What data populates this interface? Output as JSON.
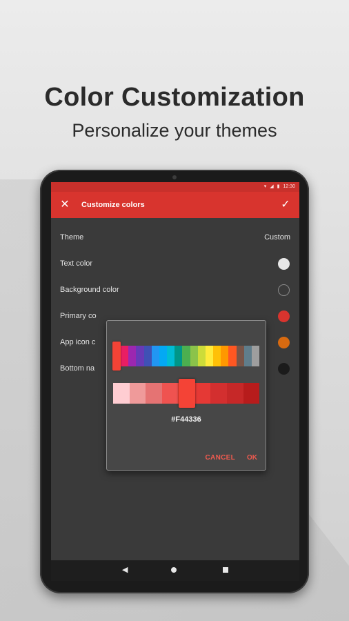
{
  "promo": {
    "headline": "Color Customization",
    "subheadline": "Personalize your themes"
  },
  "statusbar": {
    "time": "12:30",
    "icons": [
      "wifi-icon",
      "signal-icon",
      "battery-icon"
    ]
  },
  "appbar": {
    "title": "Customize colors",
    "close_icon": "close-icon",
    "confirm_icon": "check-icon",
    "color": "#d8342e"
  },
  "settings": [
    {
      "label": "Theme",
      "value": "Custom"
    },
    {
      "label": "Text color",
      "swatch": "#e8e8e8"
    },
    {
      "label": "Background color",
      "swatch": "#3a3a3a"
    },
    {
      "label": "Primary co",
      "swatch": "#d8342e"
    },
    {
      "label": "App icon c",
      "swatch": "#d86a10"
    },
    {
      "label": "Bottom na",
      "swatch": "#1b1b1b"
    }
  ],
  "color_picker": {
    "hue_colors": [
      "#f44336",
      "#e91e63",
      "#9c27b0",
      "#673ab7",
      "#3f51b5",
      "#2196f3",
      "#03a9f4",
      "#00bcd4",
      "#009688",
      "#4caf50",
      "#8bc34a",
      "#cddc39",
      "#ffeb3b",
      "#ffc107",
      "#ff9800",
      "#ff5722",
      "#795548",
      "#607d8b",
      "#9e9e9e"
    ],
    "shade_colors": [
      "#ffcdd2",
      "#ef9a9a",
      "#e57373",
      "#ef5350",
      "#f44336",
      "#e53935",
      "#d32f2f",
      "#c62828",
      "#b71c1c"
    ],
    "selected_hex": "#F44336",
    "cancel_label": "CANCEL",
    "ok_label": "OK"
  },
  "navbar": {
    "back_icon": "back-triangle-icon",
    "home_icon": "home-circle-icon",
    "recents_icon": "recents-square-icon"
  }
}
